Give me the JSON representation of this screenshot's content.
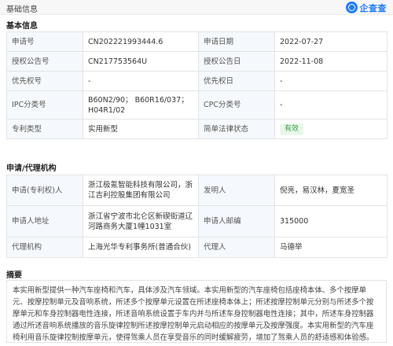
{
  "header": {
    "title": "基础信息",
    "brand": "企查查",
    "brand_icon": "qcc-logo-icon"
  },
  "basic": {
    "section_title": "基本信息",
    "rows": [
      {
        "l1": "申请号",
        "v1": "CN202221993444.6",
        "l2": "申请日期",
        "v2": "2022-07-27"
      },
      {
        "l1": "授权公告号",
        "v1": "CN217753564U",
        "l2": "授权公告日",
        "v2": "2022-11-08"
      },
      {
        "l1": "优先权号",
        "v1": "-",
        "l2": "优先权日",
        "v2": "-"
      },
      {
        "l1": "IPC分类号",
        "v1": "B60N2/90； B60R16/037； H04R1/02",
        "l2": "CPC分类号",
        "v2": "-"
      },
      {
        "l1": "专利类型",
        "v1": "实用新型",
        "l2": "简单法律状态",
        "v2": "有效"
      }
    ]
  },
  "agency": {
    "section_title": "申请/代理机构",
    "rows": [
      {
        "l1": "申请(专利权)人",
        "v1": "浙江极氪智能科技有限公司，浙江吉利控股集团有限公司",
        "l2": "发明人",
        "v2": "倪亮，易汉林，夏宽圣"
      },
      {
        "l1": "申请人地址",
        "v1": "浙江省宁波市北仑区新碶街道辽河路商务大厦1幢1031室",
        "l2": "申请人邮编",
        "v2": "315000"
      },
      {
        "l1": "代理机构",
        "v1": "上海光华专利事务所(普通合伙)",
        "l2": "代理人",
        "v2": "马德举"
      }
    ]
  },
  "abstract": {
    "section_title": "摘要",
    "text": "本实用新型提供一种汽车座椅和汽车，具体涉及汽车领域。本实用新型的汽车座椅包括座椅本体、多个按摩单元、按摩控制单元及音响系统，所述多个按摩单元设置在所述座椅本体上；所述按摩控制单元分别与所述多个按摩单元和车身控制器电性连接，所述音响系统设置于车内并与所述车身控制器电性连接；其中，所述车身控制器通过所述音响系统播放的音乐旋律控制所述按摩控制单元启动相应的按摩单元及按摩强度。本实用新型的汽车座椅利用音乐旋律控制按摩单元，使得驾乘人员在享受音乐的同时缓解疲劳，增加了驾乘人员的舒适感和体验感。"
  },
  "colors": {
    "accent": "#1f7bff",
    "status_green": "#3aa34a",
    "label_bg": "#f5f8fc"
  }
}
